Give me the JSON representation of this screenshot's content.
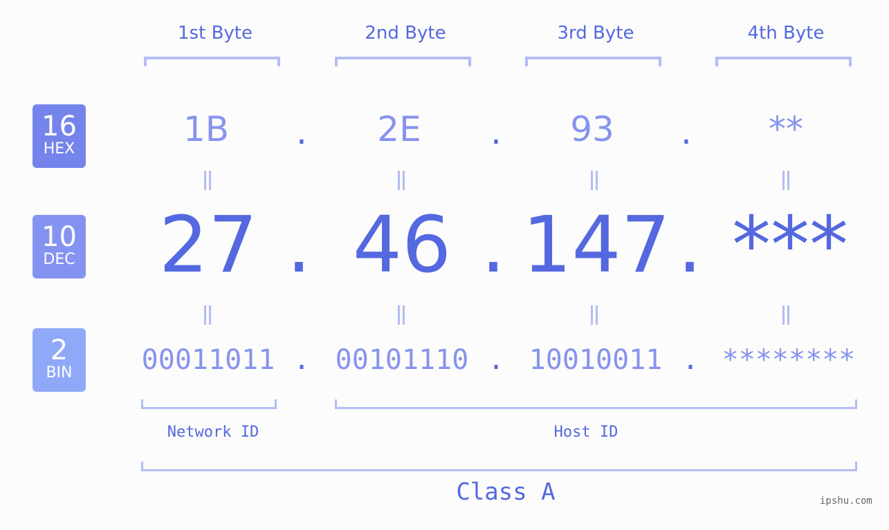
{
  "byte_headers": [
    "1st Byte",
    "2nd Byte",
    "3rd Byte",
    "4th Byte"
  ],
  "badges": [
    {
      "num": "16",
      "label": "HEX",
      "color": "#7584ea"
    },
    {
      "num": "10",
      "label": "DEC",
      "color": "#8593f0"
    },
    {
      "num": "2",
      "label": "BIN",
      "color": "#90a8f8"
    }
  ],
  "hex": [
    "1B",
    "2E",
    "93",
    "**"
  ],
  "dec": [
    "27",
    "46",
    "147",
    "***"
  ],
  "bin": [
    "00011011",
    "00101110",
    "10010011",
    "********"
  ],
  "separator": ".",
  "network_id_label": "Network ID",
  "host_id_label": "Host ID",
  "class_label": "Class A",
  "watermark": "ipshu.com",
  "colors": {
    "accent": "#5468e0",
    "light_text": "#8793ee",
    "bracket": "#b3bcf5",
    "background": "#fbfcfb"
  }
}
